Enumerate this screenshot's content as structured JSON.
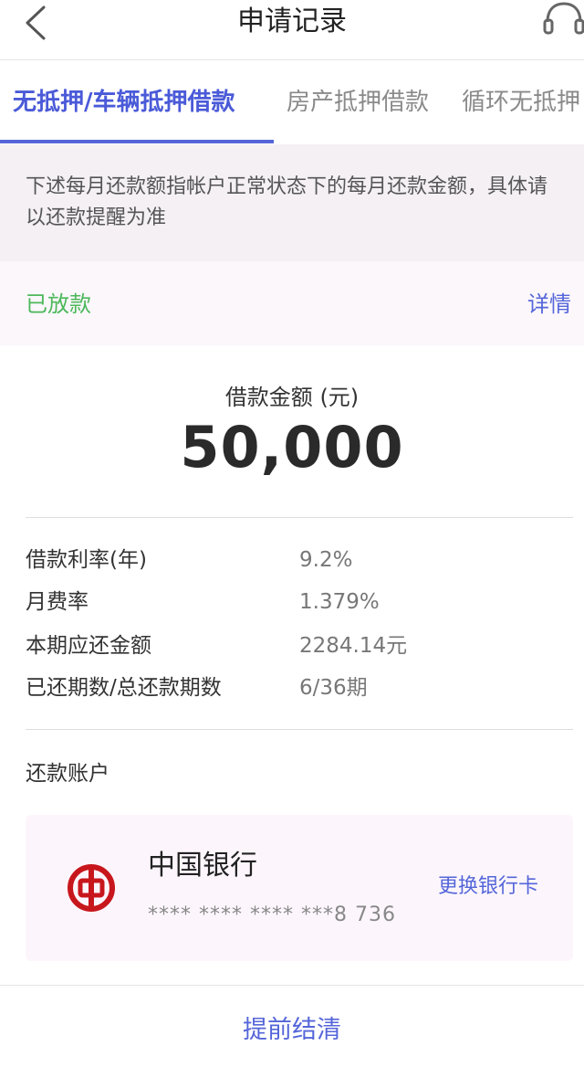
{
  "header": {
    "title": "申请记录",
    "back_icon": "chevron-left-icon",
    "support_icon": "headset-icon"
  },
  "tabs": [
    {
      "label": "无抵押/车辆抵押借款",
      "active": true
    },
    {
      "label": "房产抵押借款",
      "active": false
    },
    {
      "label": "循环无抵押",
      "active": false
    }
  ],
  "notice": {
    "text": "下述每月还款额指帐户正常状态下的每月还款金额，具体请以还款提醒为准"
  },
  "status": {
    "label": "已放款",
    "detail_link": "详情"
  },
  "loan": {
    "amount_label": "借款金额 (元)",
    "amount_value": "50,000"
  },
  "info": [
    {
      "label": "借款利率(年)",
      "value": "9.2%"
    },
    {
      "label": "月费率",
      "value": "1.379%"
    },
    {
      "label": "本期应还金额",
      "value": "2284.14元"
    },
    {
      "label": "已还期数/总还款期数",
      "value": "6/36期"
    }
  ],
  "account": {
    "label": "还款账户",
    "bank_name": "中国银行",
    "card_number": "**** **** **** ***8 736",
    "change_label": "更换银行卡",
    "logo_icon": "bank-of-china-logo"
  },
  "footer": {
    "settle_label": "提前结清"
  },
  "colors": {
    "accent": "#5566d9",
    "status_green": "#4cb85a",
    "bank_red": "#c8161d"
  }
}
